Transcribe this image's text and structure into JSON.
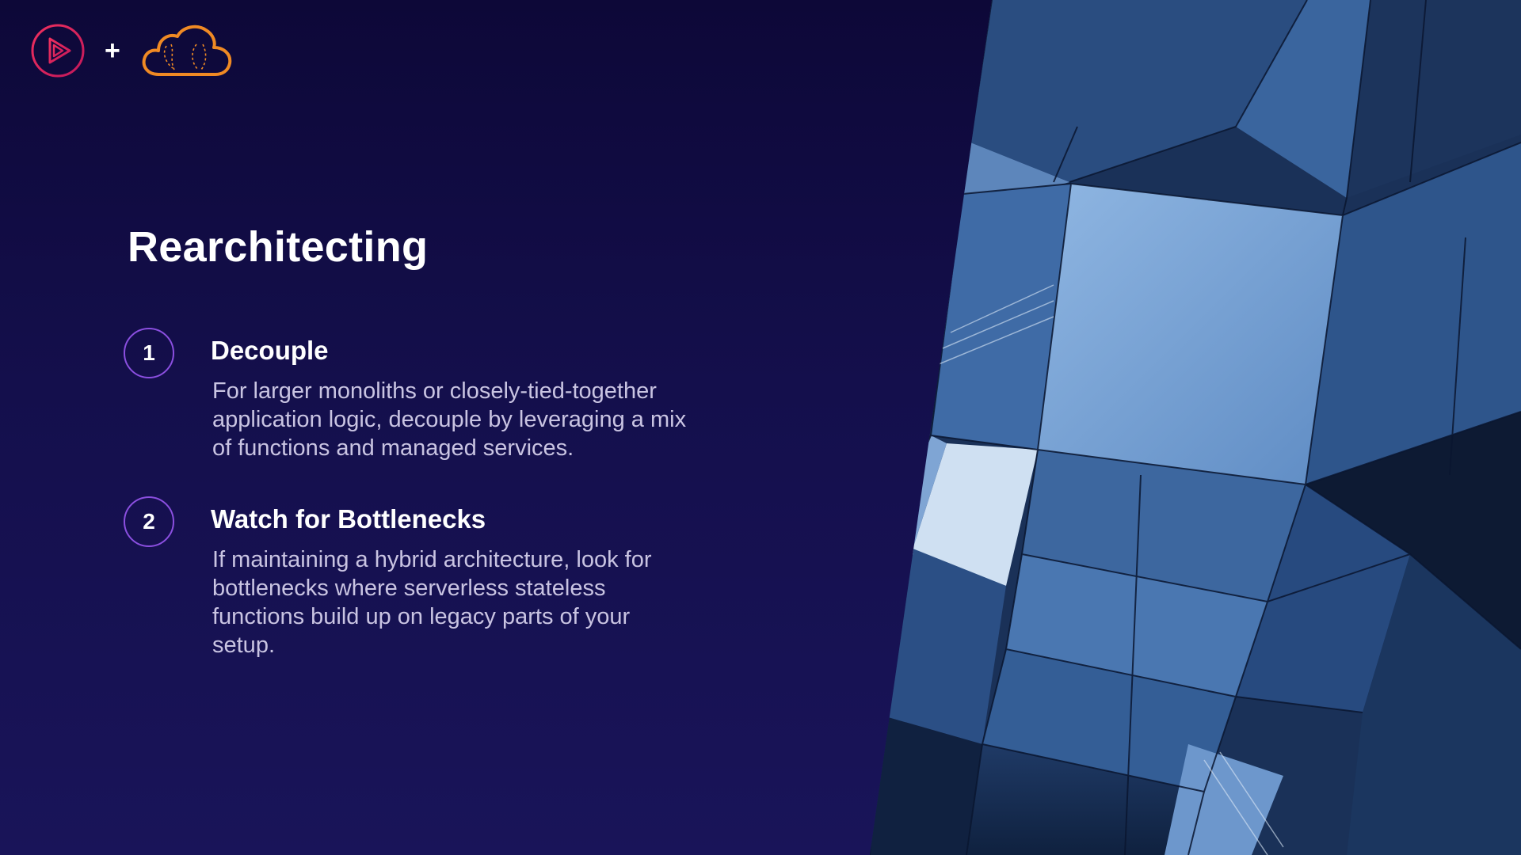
{
  "logos": {
    "first": "play-icon",
    "separator": "+",
    "second": "cloud-icon"
  },
  "slide": {
    "title": "Rearchitecting",
    "points": [
      {
        "number": "1",
        "heading": "Decouple",
        "body_lines": [
          "For larger monoliths or closely-tied-together",
          "application logic, decouple by leveraging a mix",
          "of functions and managed services."
        ]
      },
      {
        "number": "2",
        "heading": "Watch for Bottlenecks",
        "body_lines": [
          "If maintaining a hybrid architecture, look for",
          "bottlenecks where serverless stateless",
          "functions build up on legacy parts of your",
          "setup."
        ]
      }
    ]
  },
  "colors": {
    "background_top": "#0d0838",
    "background_bottom": "#191459",
    "number_ring": "#8b4fe0",
    "body_text": "#c9c4e2",
    "play_logo": "#e0245e",
    "cloud_logo": "#f08a24"
  },
  "image": {
    "subject": "glass-building-photo"
  }
}
